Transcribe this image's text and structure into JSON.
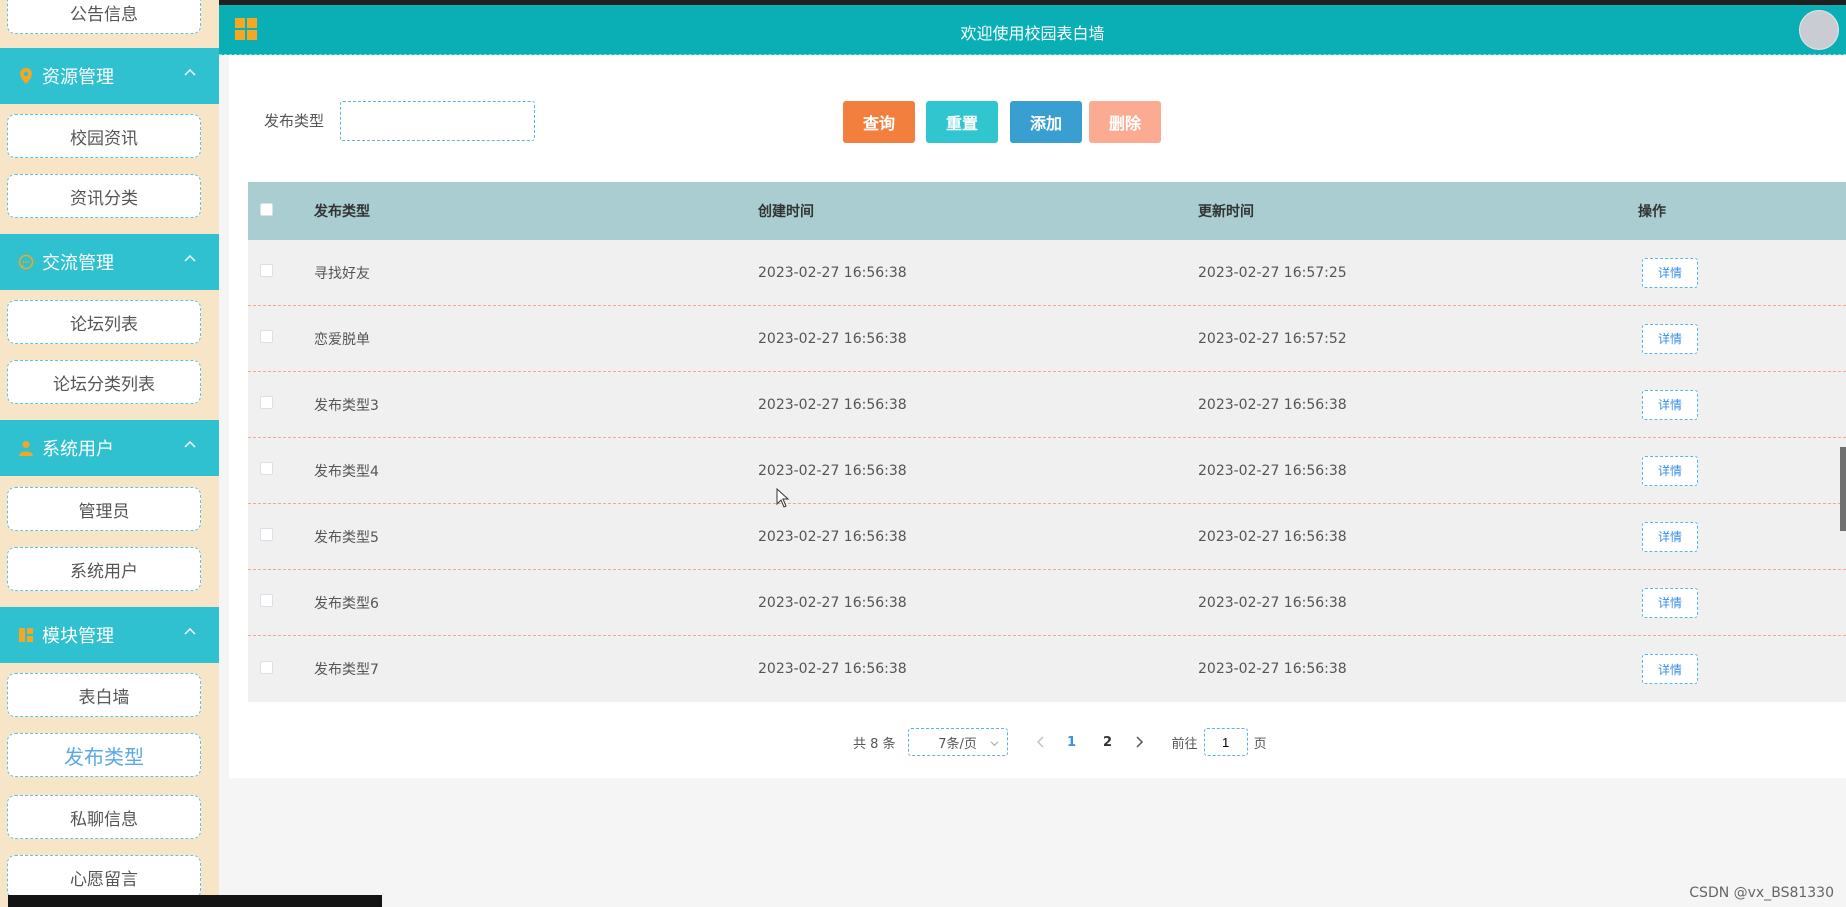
{
  "sidebar": {
    "top_item": "公告信息",
    "groups": [
      {
        "label": "资源管理",
        "icon": "location-pin-icon",
        "items": [
          "校园资讯",
          "资讯分类"
        ]
      },
      {
        "label": "交流管理",
        "icon": "chat-bubble-icon",
        "items": [
          "论坛列表",
          "论坛分类列表"
        ]
      },
      {
        "label": "系统用户",
        "icon": "user-icon",
        "items": [
          "管理员",
          "系统用户"
        ]
      },
      {
        "label": "模块管理",
        "icon": "modules-icon",
        "items": [
          "表白墙",
          "发布类型",
          "私聊信息",
          "心愿留言"
        ]
      }
    ],
    "active_item": "发布类型"
  },
  "header": {
    "title": "欢迎使用校园表白墙",
    "menu_icon": "grid-icon",
    "avatar": "avatar"
  },
  "search": {
    "label": "发布类型",
    "value": "",
    "placeholder": ""
  },
  "buttons": {
    "query": "查询",
    "reset": "重置",
    "add": "添加",
    "delete": "删除"
  },
  "table": {
    "columns": [
      "发布类型",
      "创建时间",
      "更新时间",
      "操作"
    ],
    "rows": [
      {
        "type": "寻找好友",
        "created": "2023-02-27 16:56:38",
        "updated": "2023-02-27 16:57:25",
        "action": "详情"
      },
      {
        "type": "恋爱脱单",
        "created": "2023-02-27 16:56:38",
        "updated": "2023-02-27 16:57:52",
        "action": "详情"
      },
      {
        "type": "发布类型3",
        "created": "2023-02-27 16:56:38",
        "updated": "2023-02-27 16:56:38",
        "action": "详情"
      },
      {
        "type": "发布类型4",
        "created": "2023-02-27 16:56:38",
        "updated": "2023-02-27 16:56:38",
        "action": "详情"
      },
      {
        "type": "发布类型5",
        "created": "2023-02-27 16:56:38",
        "updated": "2023-02-27 16:56:38",
        "action": "详情"
      },
      {
        "type": "发布类型6",
        "created": "2023-02-27 16:56:38",
        "updated": "2023-02-27 16:56:38",
        "action": "详情"
      },
      {
        "type": "发布类型7",
        "created": "2023-02-27 16:56:38",
        "updated": "2023-02-27 16:56:38",
        "action": "详情"
      }
    ]
  },
  "pagination": {
    "total": "共 8 条",
    "page_size": "7条/页",
    "pages": [
      "1",
      "2"
    ],
    "current_page": "1",
    "goto_prefix": "前往",
    "goto_value": "1",
    "goto_suffix": "页"
  },
  "watermark": "CSDN @vx_BS81330",
  "colors": {
    "header": "#0aafb5",
    "sidebar_group": "#2fc1cf",
    "sidebar_bg": "#f8e4c7",
    "query_button": "#f27f3e",
    "reset_button": "#31c5cf",
    "add_button": "#389fd0",
    "delete_button": "#fcab93",
    "table_header": "#a9cdd0",
    "active_link": "#5aa9e6"
  }
}
